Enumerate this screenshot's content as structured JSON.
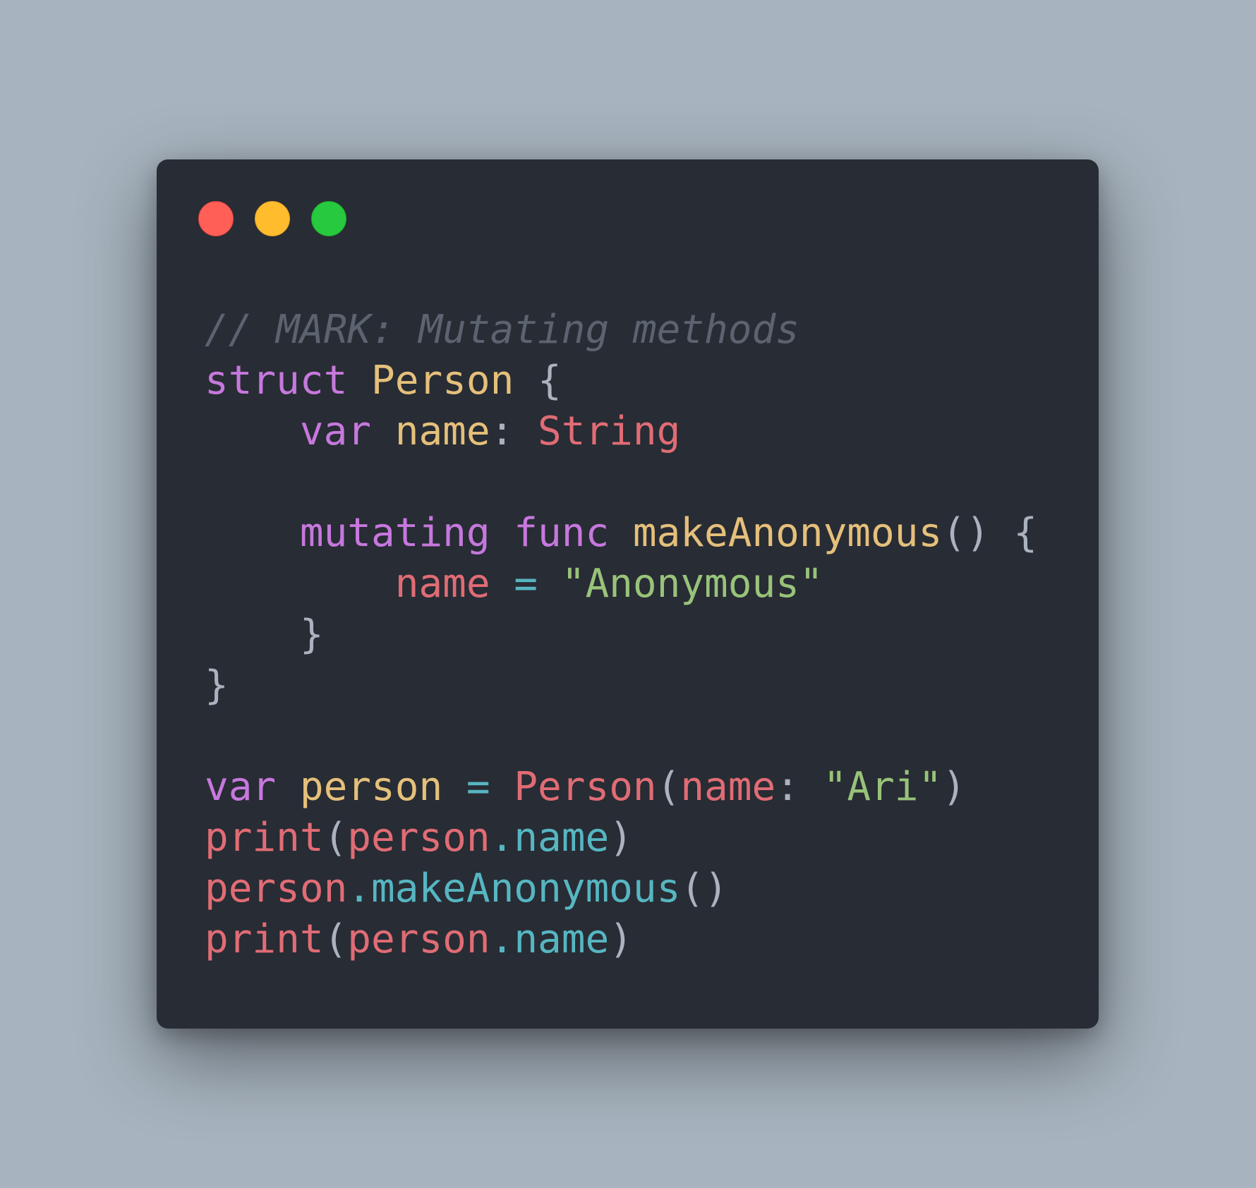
{
  "theme": {
    "background": "#a7b3be",
    "window_background": "#282c34",
    "comment": "#5c6370",
    "keyword": "#c678dd",
    "type": "#e5c07b",
    "identifier": "#e06c75",
    "string": "#98c379",
    "operator": "#56b6c2",
    "punctuation": "#abb2bf"
  },
  "window_controls": {
    "close_color": "#ff5f56",
    "minimize_color": "#ffbd2e",
    "zoom_color": "#27c93f"
  },
  "code": {
    "language": "swift",
    "lines": [
      [
        {
          "t": "// MARK: Mutating methods",
          "k": "comment"
        }
      ],
      [
        {
          "t": "struct",
          "k": "keyword"
        },
        {
          "t": " ",
          "k": "punct"
        },
        {
          "t": "Person",
          "k": "type"
        },
        {
          "t": " {",
          "k": "punct"
        }
      ],
      [
        {
          "t": "    ",
          "k": "punct"
        },
        {
          "t": "var",
          "k": "keyword"
        },
        {
          "t": " ",
          "k": "punct"
        },
        {
          "t": "name",
          "k": "type"
        },
        {
          "t": ": ",
          "k": "punct"
        },
        {
          "t": "String",
          "k": "prop"
        }
      ],
      [],
      [
        {
          "t": "    ",
          "k": "punct"
        },
        {
          "t": "mutating",
          "k": "keyword"
        },
        {
          "t": " ",
          "k": "punct"
        },
        {
          "t": "func",
          "k": "keyword"
        },
        {
          "t": " ",
          "k": "punct"
        },
        {
          "t": "makeAnonymous",
          "k": "type"
        },
        {
          "t": "() {",
          "k": "punct"
        }
      ],
      [
        {
          "t": "        ",
          "k": "punct"
        },
        {
          "t": "name",
          "k": "prop"
        },
        {
          "t": " ",
          "k": "punct"
        },
        {
          "t": "=",
          "k": "op"
        },
        {
          "t": " ",
          "k": "punct"
        },
        {
          "t": "\"Anonymous\"",
          "k": "string"
        }
      ],
      [
        {
          "t": "    }",
          "k": "punct"
        }
      ],
      [
        {
          "t": "}",
          "k": "punct"
        }
      ],
      [],
      [
        {
          "t": "var",
          "k": "keyword"
        },
        {
          "t": " ",
          "k": "punct"
        },
        {
          "t": "person",
          "k": "type"
        },
        {
          "t": " ",
          "k": "punct"
        },
        {
          "t": "=",
          "k": "op"
        },
        {
          "t": " ",
          "k": "punct"
        },
        {
          "t": "Person",
          "k": "prop"
        },
        {
          "t": "(",
          "k": "punct"
        },
        {
          "t": "name",
          "k": "prop"
        },
        {
          "t": ": ",
          "k": "punct"
        },
        {
          "t": "\"Ari\"",
          "k": "string"
        },
        {
          "t": ")",
          "k": "punct"
        }
      ],
      [
        {
          "t": "print",
          "k": "prop"
        },
        {
          "t": "(",
          "k": "punct"
        },
        {
          "t": "person",
          "k": "prop"
        },
        {
          "t": ".",
          "k": "op"
        },
        {
          "t": "name",
          "k": "member"
        },
        {
          "t": ")",
          "k": "punct"
        }
      ],
      [
        {
          "t": "person",
          "k": "prop"
        },
        {
          "t": ".",
          "k": "op"
        },
        {
          "t": "makeAnonymous",
          "k": "member"
        },
        {
          "t": "()",
          "k": "punct"
        }
      ],
      [
        {
          "t": "print",
          "k": "prop"
        },
        {
          "t": "(",
          "k": "punct"
        },
        {
          "t": "person",
          "k": "prop"
        },
        {
          "t": ".",
          "k": "op"
        },
        {
          "t": "name",
          "k": "member"
        },
        {
          "t": ")",
          "k": "punct"
        }
      ]
    ]
  }
}
